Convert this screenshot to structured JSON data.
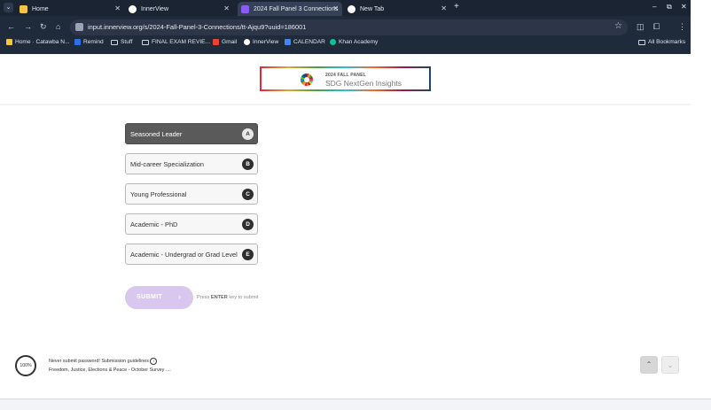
{
  "browser": {
    "tabs": [
      {
        "title": "Home",
        "favicon_color": "#f4c542"
      },
      {
        "title": "InnerView",
        "favicon_color": "#ffffff"
      },
      {
        "title": "2024 Fall Panel 3 Connections",
        "favicon_color": "#8a5cf6"
      },
      {
        "title": "New Tab",
        "favicon_color": "#ffffff"
      }
    ],
    "new_tab_symbol": "+",
    "url": "input.innerview.org/s/2024-Fall-Panel-3-Connections/tt-Ajqu9?uuid=186001",
    "bookmarks": [
      {
        "label": "Home · Catawba N...",
        "icon": "home-icon"
      },
      {
        "label": "Remind",
        "icon": "remind-icon"
      },
      {
        "label": "Stuff",
        "icon": "folder-icon"
      },
      {
        "label": "FINAL EXAM REVIE...",
        "icon": "folder-icon"
      },
      {
        "label": "Gmail",
        "icon": "gmail-icon"
      },
      {
        "label": "InnerView",
        "icon": "innerview-icon"
      },
      {
        "label": "CALENDAR",
        "icon": "calendar-icon"
      },
      {
        "label": "Khan Academy",
        "icon": "khan-icon"
      }
    ],
    "all_bookmarks": "All Bookmarks"
  },
  "logo": {
    "line1": "2024 FALL PANEL",
    "line2": "SDG NextGen Insights"
  },
  "choices": [
    {
      "label": "Seasoned Leader",
      "key": "A",
      "selected": true
    },
    {
      "label": "Mid-career Specialization",
      "key": "B",
      "selected": false
    },
    {
      "label": "Young Professional",
      "key": "C",
      "selected": false
    },
    {
      "label": "Academic - PhD",
      "key": "D",
      "selected": false
    },
    {
      "label": "Academic - Undergrad or Grad Level",
      "key": "E",
      "selected": false
    }
  ],
  "submit": {
    "label": "SUBMIT",
    "chevron": "›",
    "hint_prefix": "Press ",
    "hint_key": "ENTER",
    "hint_suffix": " key to submit"
  },
  "footer": {
    "progress": "100%",
    "line1": "Never submit password! Submission guidelines",
    "line2": "Freedom, Justice, Elections & Peace - October Survey ...."
  },
  "colors": {
    "accent": "#d9c7f0",
    "selected_choice": "#5a5a5a"
  }
}
